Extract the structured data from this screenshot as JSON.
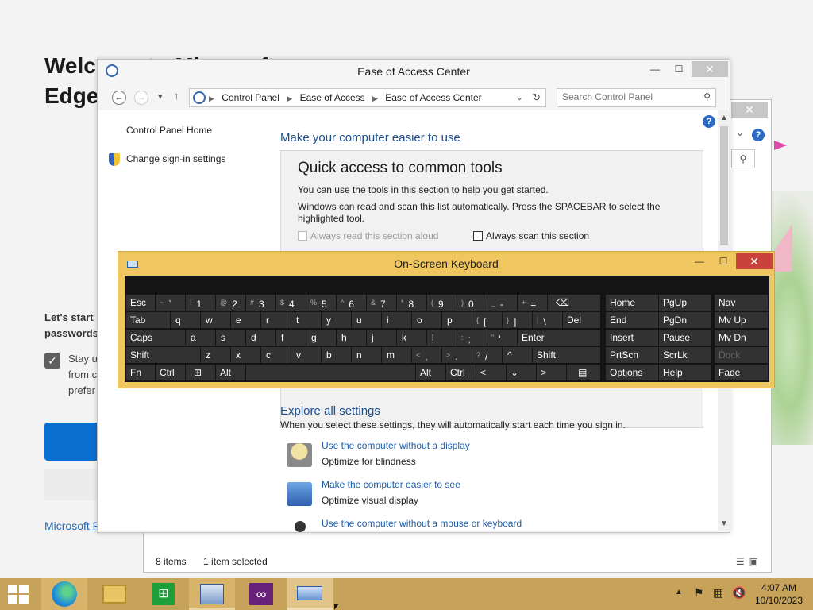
{
  "background": {
    "edge_heading": "Welcome to Microsoft Edge, your browser",
    "lets_start": "Let's start passwords",
    "stay_text": "Stay u from c prefer",
    "ms_link": "Microsoft P"
  },
  "explorer_bg": {
    "status_items": "8 items",
    "status_selected": "1 item selected",
    "close": "✕",
    "help": "?"
  },
  "eoa": {
    "title": "Ease of Access Center",
    "address": {
      "crumbs": [
        "Control Panel",
        "Ease of Access",
        "Ease of Access Center"
      ],
      "search_placeholder": "Search Control Panel"
    },
    "left": {
      "home": "Control Panel Home",
      "signin": "Change sign-in settings"
    },
    "heading": "Make your computer easier to use",
    "quick": {
      "title": "Quick access to common tools",
      "p1": "You can use the tools in this section to help you get started.",
      "p2": "Windows can read and scan this list automatically.  Press the SPACEBAR to select the highlighted tool.",
      "cb_read": "Always read this section aloud",
      "cb_scan": "Always scan this section"
    },
    "explore": {
      "heading": "Explore all settings",
      "sub": "When you select these settings, they will automatically start each time you sign in.",
      "items": [
        {
          "link": "Use the computer without a display",
          "desc": "Optimize for blindness"
        },
        {
          "link": "Make the computer easier to see",
          "desc": "Optimize visual display"
        },
        {
          "link": "Use the computer without a mouse or keyboard",
          "desc": ""
        }
      ]
    }
  },
  "osk": {
    "title": "On-Screen Keyboard",
    "keys": {
      "esc": "Esc",
      "tilde_sh": "~",
      "tilde": "`",
      "n1_sh": "!",
      "n1": "1",
      "n2_sh": "@",
      "n2": "2",
      "n3_sh": "#",
      "n3": "3",
      "n4_sh": "$",
      "n4": "4",
      "n5_sh": "%",
      "n5": "5",
      "n6_sh": "^",
      "n6": "6",
      "n7_sh": "&",
      "n7": "7",
      "n8_sh": "*",
      "n8": "8",
      "n9_sh": "(",
      "n9": "9",
      "n0_sh": ")",
      "n0": "0",
      "minus_sh": "_",
      "minus": "-",
      "eq_sh": "+",
      "eq": "=",
      "bksp": "⌫",
      "home": "Home",
      "pgup": "PgUp",
      "nav": "Nav",
      "tab": "Tab",
      "q": "q",
      "w": "w",
      "e": "e",
      "r": "r",
      "t": "t",
      "y": "y",
      "u": "u",
      "i": "i",
      "o": "o",
      "p": "p",
      "lbr_sh": "{",
      "lbr": "[",
      "rbr_sh": "}",
      "rbr": "]",
      "bsl_sh": "|",
      "bsl": "\\",
      "del": "Del",
      "end": "End",
      "pgdn": "PgDn",
      "mvup": "Mv Up",
      "caps": "Caps",
      "a": "a",
      "s": "s",
      "d": "d",
      "f": "f",
      "g": "g",
      "h": "h",
      "j": "j",
      "k": "k",
      "l": "l",
      "semi_sh": ":",
      "semi": ";",
      "quote_sh": "\"",
      "quote": "'",
      "enter": "Enter",
      "insert": "Insert",
      "pause": "Pause",
      "mvdn": "Mv Dn",
      "shift": "Shift",
      "z": "z",
      "x": "x",
      "c": "c",
      "v": "v",
      "b": "b",
      "n": "n",
      "m": "m",
      "comma_sh": "<",
      "comma": ",",
      "period_sh": ">",
      "period": ".",
      "slash_sh": "?",
      "slash": "/",
      "up": "^",
      "shift_r": "Shift",
      "prtscn": "PrtScn",
      "scrlk": "ScrLk",
      "dock": "Dock",
      "fn": "Fn",
      "ctrl": "Ctrl",
      "win": "⊞",
      "alt": "Alt",
      "alt_r": "Alt",
      "ctrl_r": "Ctrl",
      "left": "<",
      "down": "⌄",
      "right": ">",
      "menu": "▤",
      "options": "Options",
      "help": "Help",
      "fade": "Fade"
    }
  },
  "taskbar": {
    "time": "4:07 AM",
    "date": "10/10/2023"
  }
}
